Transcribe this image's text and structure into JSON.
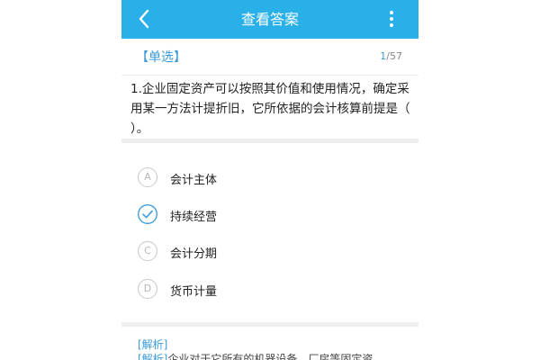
{
  "header": {
    "back_icon": "chevron-left-icon",
    "title": "查看答案",
    "more_icon": "more-vertical-icon"
  },
  "question": {
    "type": "【单选】",
    "current": "1",
    "separator": "/",
    "total": "57",
    "text": "1.企业固定资产可以按照其价值和使用情况，确定采用某一方法计提折旧，它所依据的会计核算前提是（ ）。",
    "options": [
      {
        "letter": "A",
        "text": "会计主体",
        "selected": false
      },
      {
        "letter": "B",
        "text": "持续经营",
        "selected": true
      },
      {
        "letter": "C",
        "text": "会计分期",
        "selected": false
      },
      {
        "letter": "D",
        "text": "货币计量",
        "selected": false
      }
    ]
  },
  "analysis": {
    "title": "[解析]",
    "prefix": "[解析]",
    "body": "企业对于它所有的机器设备、厂房等固定资"
  },
  "colors": {
    "header_bg": "#29b0e8",
    "accent": "#3a9bd9"
  }
}
